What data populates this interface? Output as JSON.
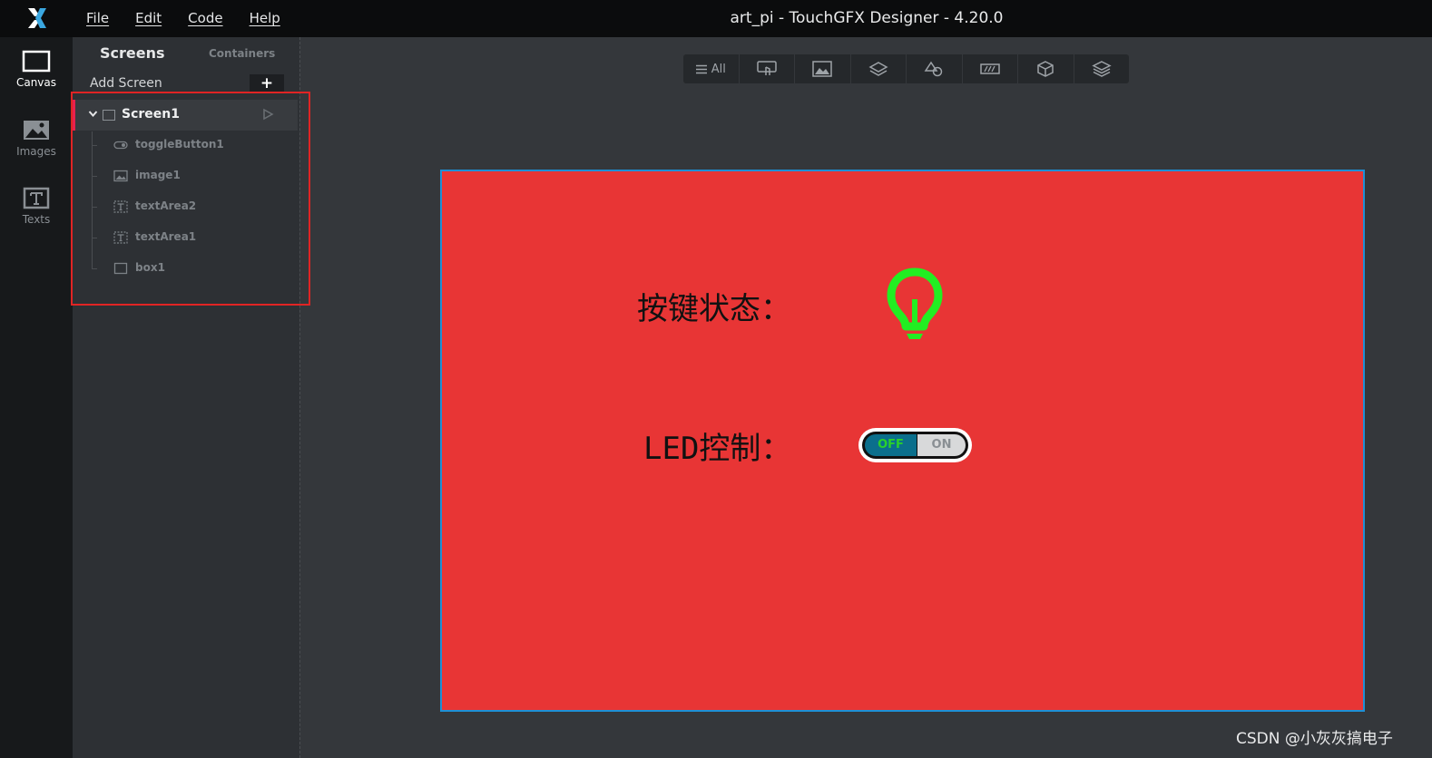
{
  "app": {
    "title": "art_pi - TouchGFX Designer - 4.20.0",
    "menu": [
      {
        "label": "File"
      },
      {
        "label": "Edit"
      },
      {
        "label": "Code"
      },
      {
        "label": "Help"
      }
    ]
  },
  "leftbar": {
    "items": [
      {
        "label": "Canvas",
        "icon": "canvas-icon",
        "active": true
      },
      {
        "label": "Images",
        "icon": "images-icon"
      },
      {
        "label": "Texts",
        "icon": "texts-icon"
      }
    ]
  },
  "panel": {
    "tab_screens": "Screens",
    "tab_containers": "Containers",
    "add_screen": "Add Screen",
    "add_symbol": "+",
    "screen": {
      "name": "Screen1"
    },
    "widgets": [
      {
        "name": "toggleButton1",
        "icon": "toggle-icon"
      },
      {
        "name": "image1",
        "icon": "image-icon"
      },
      {
        "name": "textArea2",
        "icon": "text-icon"
      },
      {
        "name": "textArea1",
        "icon": "text-icon"
      },
      {
        "name": "box1",
        "icon": "box-icon"
      }
    ]
  },
  "toolbar": {
    "all_label": "All",
    "icons": [
      "touch-icon",
      "image-icon",
      "layers-icon",
      "shapes-icon",
      "progress-icon",
      "cube-icon",
      "stack-icon"
    ]
  },
  "canvas": {
    "background": "#e83535",
    "label1": "按键状态：",
    "label2": "LED控制：",
    "bulb_color": "#22ee22",
    "toggle": {
      "off_label": "OFF",
      "on_label": "ON"
    }
  },
  "watermark": "CSDN @小灰灰搞电子",
  "colors": {
    "accent": "#e8214d",
    "highlight": "#e02424",
    "canvas_border": "#1e90d6"
  }
}
